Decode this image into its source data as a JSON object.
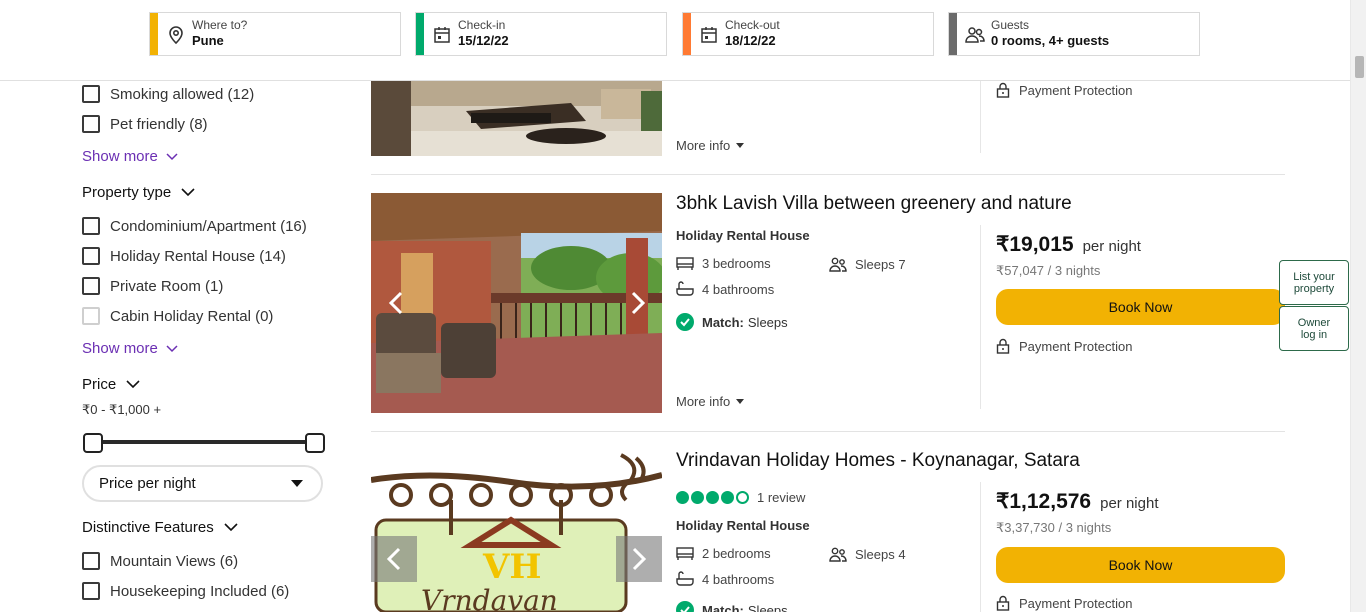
{
  "search": {
    "where": {
      "label": "Where to?",
      "value": "Pune",
      "color": "#f2b203"
    },
    "checkin": {
      "label": "Check-in",
      "value": "15/12/22",
      "color": "#00aa6c"
    },
    "checkout": {
      "label": "Check-out",
      "value": "18/12/22",
      "color": "#ff7a33"
    },
    "guests": {
      "label": "Guests",
      "value": "0 rooms, 4+ guests",
      "color": "#6b6b6b"
    }
  },
  "sidebar": {
    "amenities": [
      {
        "label": "Smoking allowed (12)"
      },
      {
        "label": "Pet friendly (8)"
      }
    ],
    "show_more": "Show more",
    "property_type": {
      "title": "Property type",
      "items": [
        {
          "label": "Condominium/Apartment (16)"
        },
        {
          "label": "Holiday Rental House (14)"
        },
        {
          "label": "Private Room (1)"
        },
        {
          "label": "Cabin Holiday Rental (0)"
        }
      ]
    },
    "price": {
      "title": "Price",
      "range": "₹0 - ₹1,000 +",
      "select": "Price per night"
    },
    "features": {
      "title": "Distinctive Features",
      "items": [
        {
          "label": "Mountain Views (6)"
        },
        {
          "label": "Housekeeping Included (6)"
        }
      ]
    }
  },
  "listings": [
    {
      "more_info": "More info",
      "protection": "Payment Protection"
    },
    {
      "title": "3bhk Lavish Villa between greenery and nature",
      "type": "Holiday Rental House",
      "bedrooms": "3 bedrooms",
      "bathrooms": "4 bathrooms",
      "sleeps": "Sleeps 7",
      "match_label": "Match:",
      "match_value": "Sleeps",
      "more_info": "More info",
      "price": "₹19,015",
      "per_night": "per night",
      "total": "₹57,047 / 3 nights",
      "book": "Book Now",
      "protection": "Payment Protection"
    },
    {
      "title": "Vrindavan Holiday Homes - Koynanagar, Satara",
      "rating": 4,
      "reviews": "1 review",
      "type": "Holiday Rental House",
      "bedrooms": "2 bedrooms",
      "bathrooms": "4 bathrooms",
      "sleeps": "Sleeps 4",
      "match_label": "Match:",
      "match_value": "Sleeps",
      "price": "₹1,12,576",
      "per_night": "per night",
      "total": "₹3,37,730 / 3 nights",
      "book": "Book Now",
      "protection": "Payment Protection"
    }
  ],
  "side_buttons": {
    "list_property": "List your property",
    "owner_login": "Owner log in"
  },
  "colors": {
    "accent_yellow": "#f2b203",
    "link_purple": "#6b2fb3",
    "green": "#00aa6c"
  }
}
